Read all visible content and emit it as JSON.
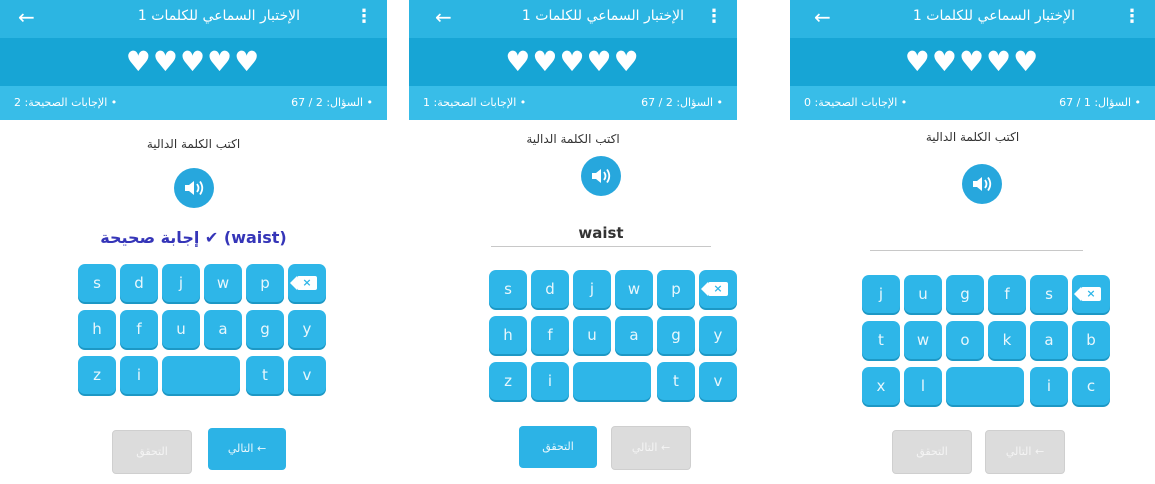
{
  "colors": {
    "appbar": "#2cb5e2",
    "hearts_bar": "#17a5d5",
    "stats_bar": "#38bde8",
    "key": "#2eb6e8",
    "feedback": "#3535b8"
  },
  "icons": {
    "back": "arrow-left-icon",
    "more": "more-vertical-icon",
    "speaker": "speaker-icon",
    "delete": "backspace-icon"
  },
  "screens": [
    {
      "title": "الإختبار السماعي للكلمات 1",
      "back": "←",
      "more": "⋮",
      "hearts": "♥♥♥♥♥",
      "question": "• السؤال: 2 / 67",
      "correct": "• الإجابات الصحيحة: 2",
      "prompt": "اكتب الكلمة الدالية",
      "feedback": "إجابة صحيحة ✔ (waist)",
      "keys": [
        "s",
        "d",
        "j",
        "w",
        "p",
        "h",
        "f",
        "u",
        "a",
        "g",
        "y",
        "z",
        "i",
        "t",
        "v"
      ],
      "delete": "×",
      "check_button": "التحقق",
      "next_button": "← التالي"
    },
    {
      "title": "الإختبار السماعي للكلمات 1",
      "back": "←",
      "more": "⋮",
      "hearts": "♥♥♥♥♥",
      "question": "• السؤال: 2 / 67",
      "correct": "• الإجابات الصحيحة: 1",
      "prompt": "اكتب الكلمة الدالية",
      "answer": "waist",
      "keys": [
        "s",
        "d",
        "j",
        "w",
        "p",
        "h",
        "f",
        "u",
        "a",
        "g",
        "y",
        "z",
        "i",
        "t",
        "v"
      ],
      "delete": "×",
      "check_button": "التحقق",
      "next_button": "← التالي"
    },
    {
      "title": "الإختبار السماعي للكلمات 1",
      "back": "←",
      "more": "⋮",
      "hearts": "♥♥♥♥♥",
      "question": "• السؤال: 1 / 67",
      "correct": "• الإجابات الصحيحة: 0",
      "prompt": "اكتب الكلمة الدالية",
      "answer": "",
      "keys": [
        "j",
        "u",
        "g",
        "f",
        "s",
        "t",
        "w",
        "o",
        "k",
        "a",
        "b",
        "x",
        "l",
        "i",
        "c"
      ],
      "delete": "×",
      "check_button": "التحقق",
      "next_button": "← التالي"
    }
  ]
}
